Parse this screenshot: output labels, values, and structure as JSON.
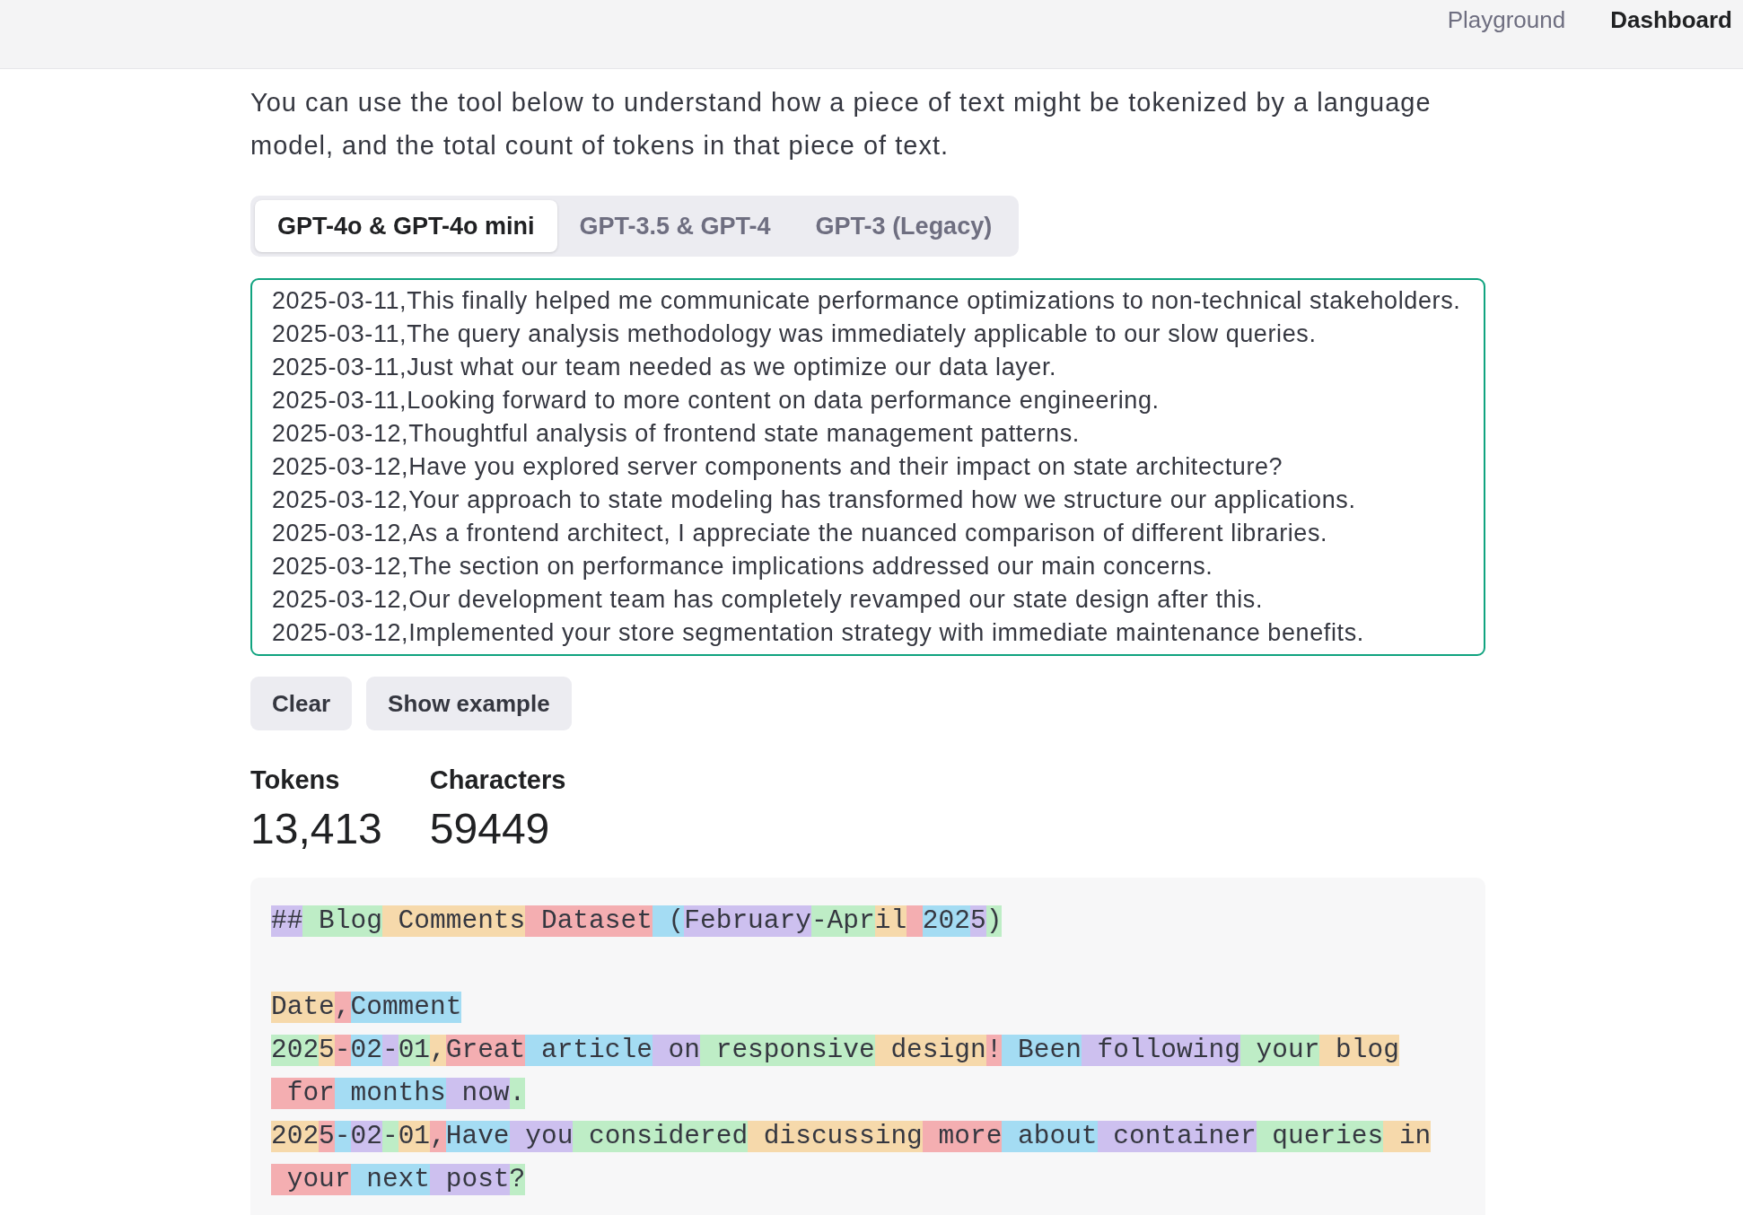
{
  "header": {
    "nav": [
      {
        "label": "Playground",
        "selected": false
      },
      {
        "label": "Dashboard",
        "selected": true
      }
    ]
  },
  "intro": "You can use the tool below to understand how a piece of text might be tokenized by a language model, and the total count of tokens in that piece of text.",
  "tabs": [
    {
      "label": "GPT-4o & GPT-4o mini",
      "selected": true
    },
    {
      "label": "GPT-3.5 & GPT-4",
      "selected": false
    },
    {
      "label": "GPT-3 (Legacy)",
      "selected": false
    }
  ],
  "input": {
    "lines": [
      "2025-03-11,This finally helped me communicate performance optimizations to non-technical stakeholders.",
      "2025-03-11,The query analysis methodology was immediately applicable to our slow queries.",
      "2025-03-11,Just what our team needed as we optimize our data layer.",
      "2025-03-11,Looking forward to more content on data performance engineering.",
      "2025-03-12,Thoughtful analysis of frontend state management patterns.",
      "2025-03-12,Have you explored server components and their impact on state architecture?",
      "2025-03-12,Your approach to state modeling has transformed how we structure our applications.",
      "2025-03-12,As a frontend architect, I appreciate the nuanced comparison of different libraries.",
      "2025-03-12,The section on performance implications addressed our main concerns.",
      "2025-03-12,Our development team has completely revamped our state design after this.",
      "2025-03-12,Implemented your store segmentation strategy with immediate maintenance benefits."
    ]
  },
  "buttons": [
    "Clear",
    "Show example"
  ],
  "stats": [
    {
      "label": "Tokens",
      "value": "13,413"
    },
    {
      "label": "Characters",
      "value": "59449"
    }
  ],
  "token_view": {
    "lines": [
      {
        "kind": "tokens",
        "tokens": [
          {
            "kind": "text",
            "text": "##",
            "color": "#cdc0ef"
          },
          {
            "kind": "text",
            "text": " Blog",
            "color": "#beedc6"
          },
          {
            "kind": "text",
            "text": " Comments",
            "color": "#f6d9ab"
          },
          {
            "kind": "text",
            "text": " Dataset",
            "color": "#f4aeb1"
          },
          {
            "kind": "text",
            "text": " (",
            "color": "#a4dcf3"
          },
          {
            "kind": "text",
            "text": "February",
            "color": "#cdc0ef"
          },
          {
            "kind": "text",
            "text": "-Apr",
            "color": "#beedc6"
          },
          {
            "kind": "text",
            "text": "il",
            "color": "#f6d9ab"
          },
          {
            "kind": "space",
            "color": "#f4aeb1"
          },
          {
            "kind": "text",
            "text": "202",
            "color": "#a4dcf3"
          },
          {
            "kind": "text",
            "text": "5",
            "color": "#cdc0ef"
          },
          {
            "kind": "text",
            "text": ")",
            "color": "#beedc6"
          }
        ]
      },
      {
        "kind": "blank"
      },
      {
        "kind": "tokens",
        "tokens": [
          {
            "text": "Date",
            "color": "#f6d9ab"
          },
          {
            "text": ",",
            "color": "#f4aeb1"
          },
          {
            "text": "Comment",
            "color": "#a4dcf3"
          }
        ]
      },
      {
        "kind": "tokens",
        "tokens": [
          {
            "text": "202",
            "color": "#beedc6"
          },
          {
            "text": "5",
            "color": "#f6d9ab"
          },
          {
            "text": "-",
            "color": "#f4aeb1"
          },
          {
            "text": "02",
            "color": "#a4dcf3"
          },
          {
            "text": "-",
            "color": "#cdc0ef"
          },
          {
            "text": "01",
            "color": "#beedc6"
          },
          {
            "text": ",",
            "color": "#f6d9ab"
          },
          {
            "text": "Great",
            "color": "#f4aeb1"
          },
          {
            "text": " article",
            "color": "#a4dcf3"
          },
          {
            "text": " on",
            "color": "#cdc0ef"
          },
          {
            "text": " responsive",
            "color": "#beedc6"
          },
          {
            "text": " design",
            "color": "#f6d9ab"
          },
          {
            "text": "!",
            "color": "#f4aeb1"
          },
          {
            "text": " Been",
            "color": "#a4dcf3"
          },
          {
            "text": " following",
            "color": "#cdc0ef"
          },
          {
            "text": " your",
            "color": "#beedc6"
          },
          {
            "text": " blog",
            "color": "#f6d9ab"
          },
          {
            "text": " for",
            "color": "#f4aeb1"
          },
          {
            "text": " months",
            "color": "#a4dcf3"
          },
          {
            "text": " now",
            "color": "#cdc0ef"
          },
          {
            "text": ".",
            "color": "#beedc6"
          }
        ]
      },
      {
        "kind": "tokens",
        "tokens": [
          {
            "text": "202",
            "color": "#f6d9ab"
          },
          {
            "text": "5",
            "color": "#f4aeb1"
          },
          {
            "text": "-",
            "color": "#a4dcf3"
          },
          {
            "text": "02",
            "color": "#cdc0ef"
          },
          {
            "text": "-",
            "color": "#beedc6"
          },
          {
            "text": "01",
            "color": "#f6d9ab"
          },
          {
            "text": ",",
            "color": "#f4aeb1"
          },
          {
            "text": "Have",
            "color": "#a4dcf3"
          },
          {
            "text": " you",
            "color": "#cdc0ef"
          },
          {
            "text": " considered",
            "color": "#beedc6"
          },
          {
            "text": " discussing",
            "color": "#f6d9ab"
          },
          {
            "text": " more",
            "color": "#f4aeb1"
          },
          {
            "text": " about",
            "color": "#a4dcf3"
          },
          {
            "text": " container",
            "color": "#cdc0ef"
          },
          {
            "text": " queries",
            "color": "#beedc6"
          },
          {
            "text": " in",
            "color": "#f6d9ab"
          },
          {
            "text": " your",
            "color": "#f4aeb1"
          },
          {
            "text": " next",
            "color": "#a4dcf3"
          },
          {
            "text": " post",
            "color": "#cdc0ef"
          },
          {
            "text": "?",
            "color": "#beedc6"
          }
        ]
      }
    ]
  }
}
